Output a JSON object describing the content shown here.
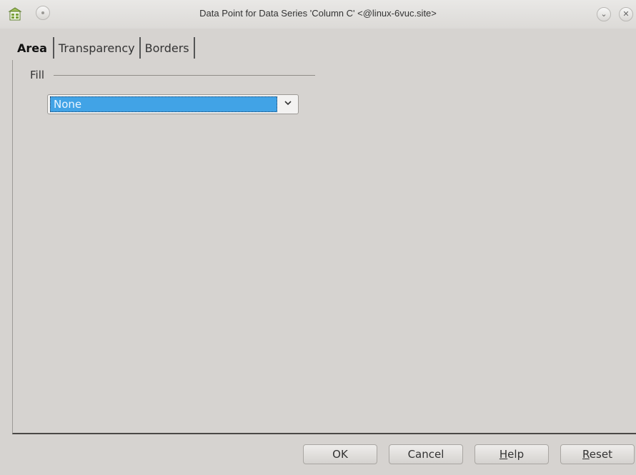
{
  "window": {
    "title": "Data Point for Data Series 'Column C' <@linux-6vuc.site>"
  },
  "tabs": [
    {
      "label": "Area",
      "active": true
    },
    {
      "label": "Transparency",
      "active": false
    },
    {
      "label": "Borders",
      "active": false
    }
  ],
  "fill": {
    "label": "Fill",
    "selected": "None"
  },
  "buttons": {
    "ok": "OK",
    "cancel": "Cancel",
    "help_first": "H",
    "help_rest": "elp",
    "reset_first": "R",
    "reset_rest": "eset"
  },
  "colors": {
    "selection": "#41a3e6",
    "window_bg": "#d6d3d0"
  },
  "icons": {
    "app": "spreadsheet-app-icon",
    "minimize": "minimize-icon",
    "shade": "chevron-down-icon",
    "close": "close-icon",
    "dropdown": "chevron-down-icon"
  }
}
